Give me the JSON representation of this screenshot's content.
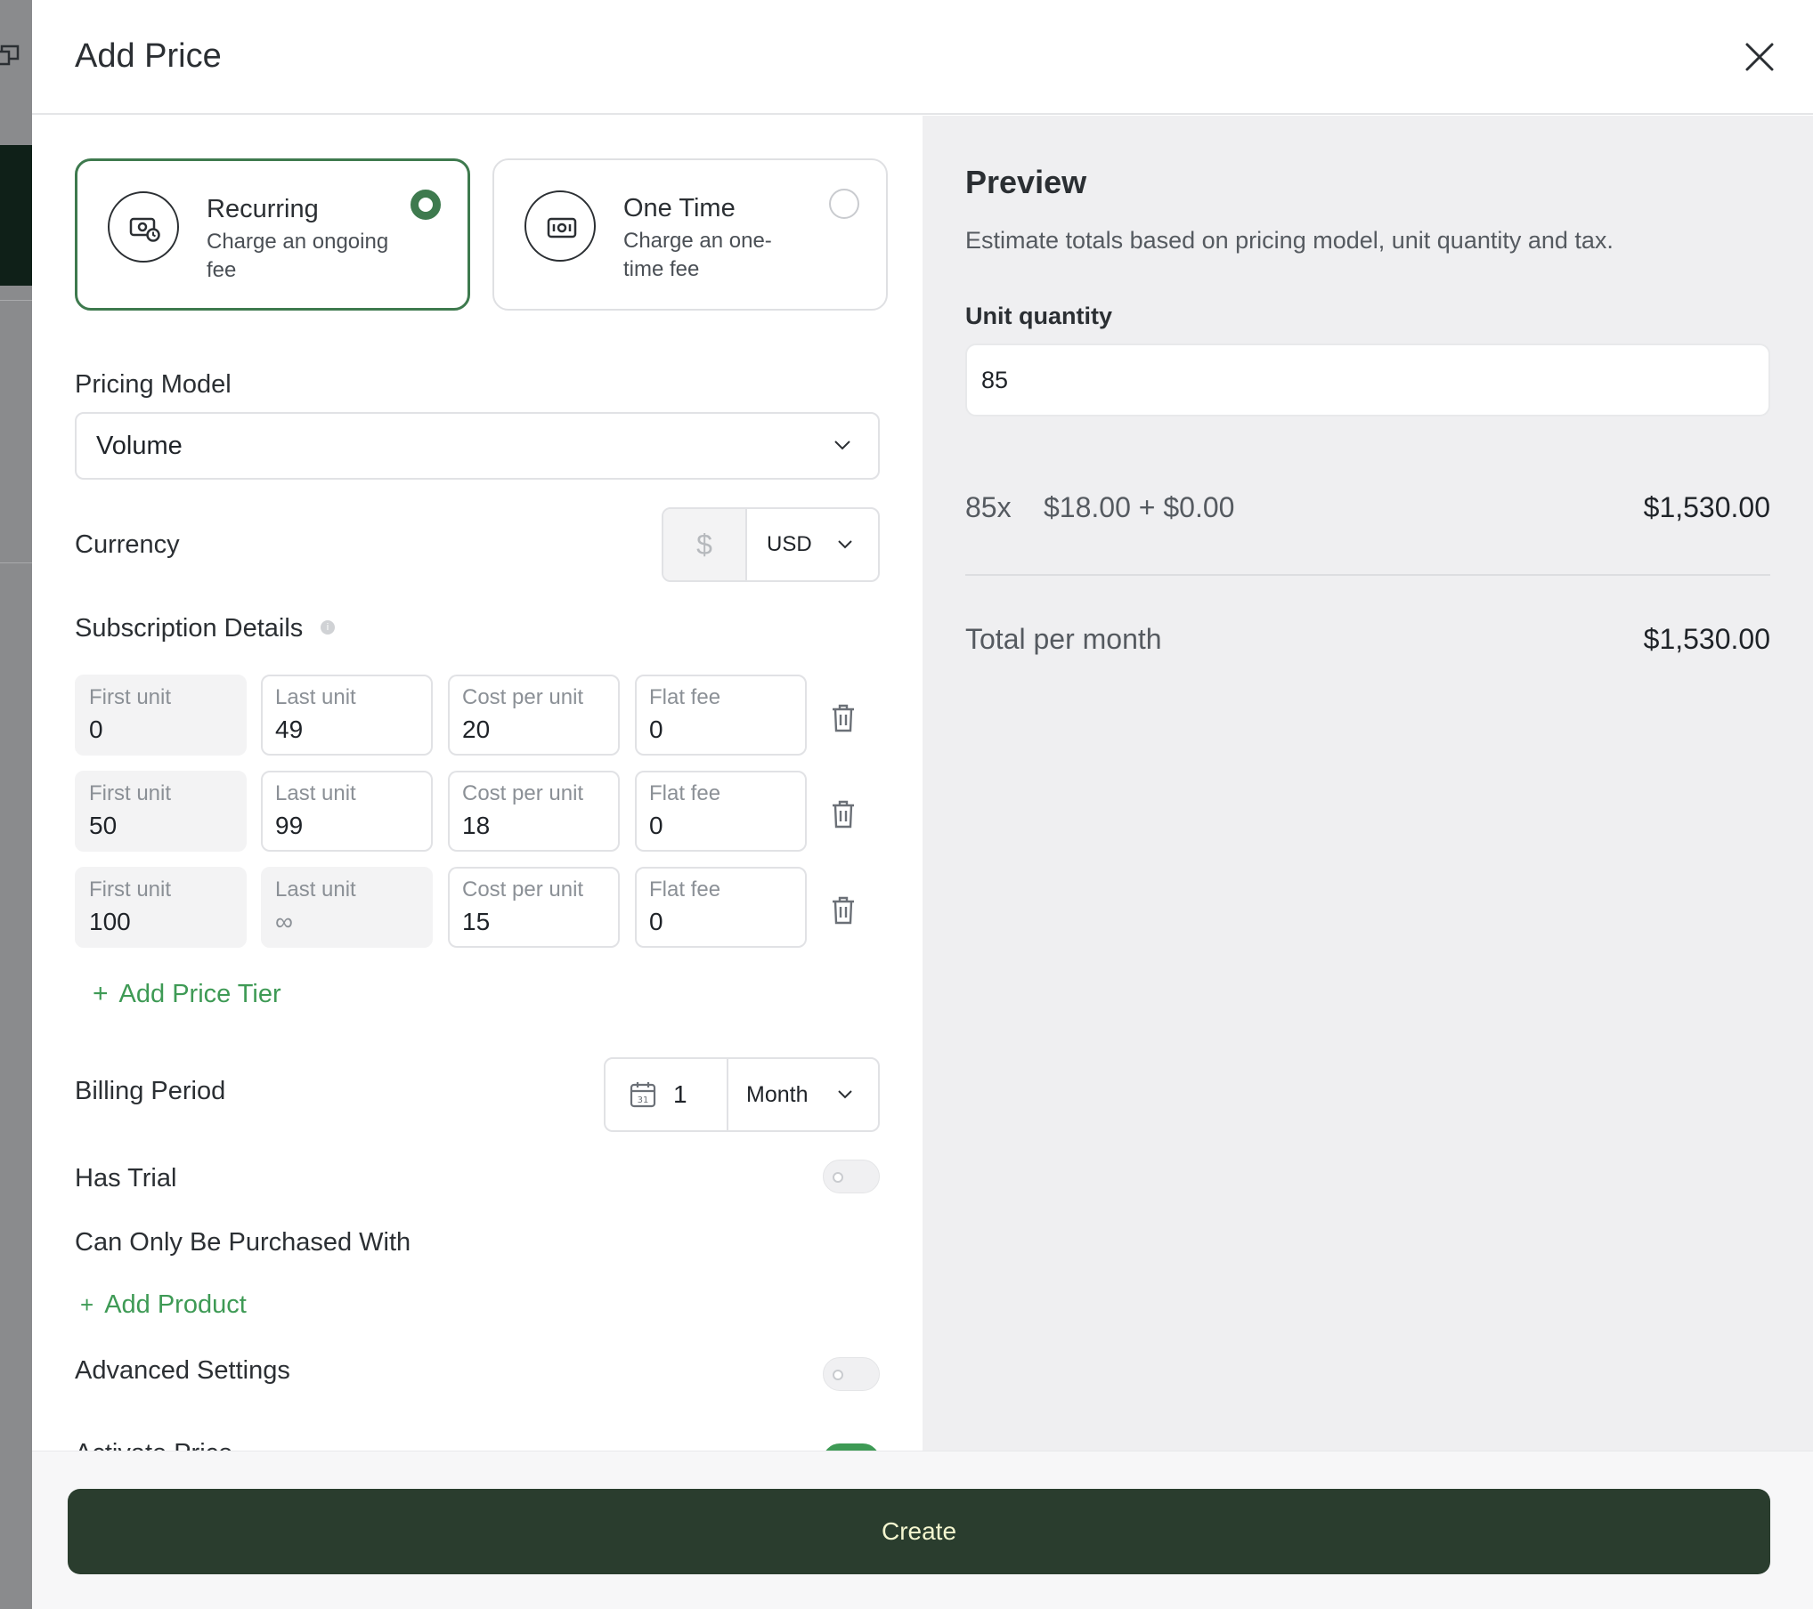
{
  "dialog": {
    "title": "Add Price"
  },
  "price_type": {
    "recurring": {
      "title": "Recurring",
      "description": "Charge an ongoing fee",
      "selected": true
    },
    "one_time": {
      "title": "One Time",
      "description": "Charge an one-time fee",
      "selected": false
    }
  },
  "pricing_model": {
    "label": "Pricing Model",
    "value": "Volume"
  },
  "currency": {
    "label": "Currency",
    "symbol": "$",
    "code": "USD"
  },
  "subscription_details": {
    "label": "Subscription Details",
    "headers": {
      "first": "First unit",
      "last": "Last unit",
      "cost": "Cost per unit",
      "fee": "Flat fee"
    },
    "tiers": [
      {
        "first": "0",
        "last": "49",
        "cost": "20",
        "fee": "0"
      },
      {
        "first": "50",
        "last": "99",
        "cost": "18",
        "fee": "0"
      },
      {
        "first": "100",
        "last": "∞",
        "cost": "15",
        "fee": "0"
      }
    ],
    "add_tier_label": "Add Price Tier"
  },
  "billing_period": {
    "label": "Billing Period",
    "count": "1",
    "unit": "Month"
  },
  "has_trial": {
    "label": "Has Trial",
    "on": false
  },
  "purchased_with": {
    "label": "Can Only Be Purchased With",
    "add_label": "Add Product"
  },
  "advanced_settings": {
    "label": "Advanced Settings",
    "on": false
  },
  "activate_price": {
    "label": "Activate Price",
    "on": true
  },
  "preview": {
    "title": "Preview",
    "subtitle": "Estimate totals based on pricing model, unit quantity and tax.",
    "unit_quantity_label": "Unit quantity",
    "unit_quantity_value": "85",
    "line_qty": "85x",
    "line_expr": "$18.00 + $0.00",
    "line_amount": "$1,530.00",
    "total_label": "Total per month",
    "total_amount": "$1,530.00"
  },
  "footer": {
    "create_label": "Create"
  },
  "colors": {
    "accent": "#3e7a4e",
    "link": "#3e9a55",
    "primary_button": "#2a3d2e",
    "primary_button_text": "#f4f6cf"
  }
}
